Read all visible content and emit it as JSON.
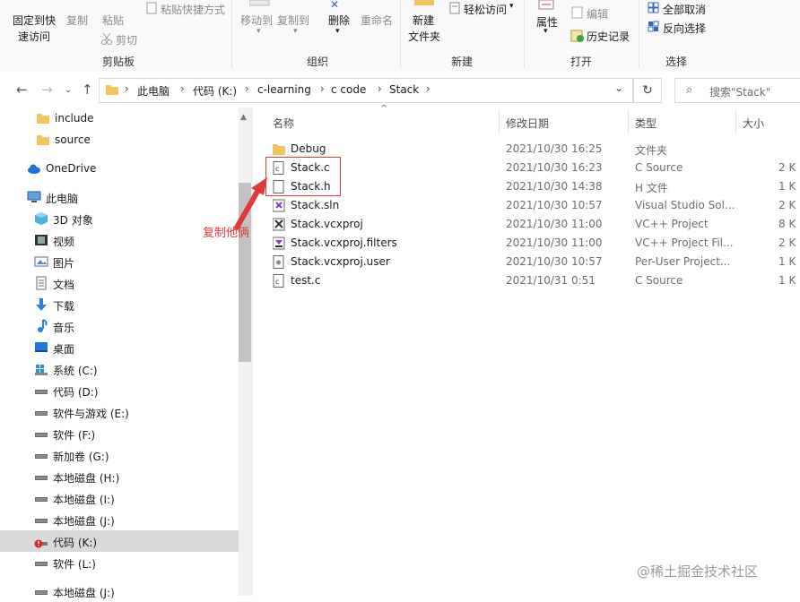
{
  "ribbon": {
    "pin_label_1": "固定到快",
    "pin_label_2": "速访问",
    "copy_label": "复制",
    "paste_label": "粘贴",
    "paste_shortcut_label": "粘贴快捷方式",
    "cut_label": "剪切",
    "move_to_label": "移动到",
    "copy_to_label": "复制到",
    "delete_label": "删除",
    "rename_label": "重命名",
    "new_folder_label_1": "新建",
    "new_folder_label_2": "文件夹",
    "easy_access_label": "轻松访问",
    "properties_label": "属性",
    "edit_label": "编辑",
    "history_label": "历史记录",
    "select_none_label": "全部取消",
    "invert_selection_label": "反向选择",
    "groups": {
      "clipboard": "剪贴板",
      "organize": "组织",
      "new": "新建",
      "open": "打开",
      "select": "选择"
    }
  },
  "address": {
    "crumbs": [
      "此电脑",
      "代码 (K:)",
      "c-learning",
      "c code",
      "Stack"
    ],
    "search_placeholder": "搜索\"Stack\""
  },
  "nav": {
    "items": [
      {
        "label": "include",
        "icon": "folder-icon"
      },
      {
        "label": "source",
        "icon": "folder-icon"
      },
      {
        "label": "OneDrive",
        "icon": "cloud-icon"
      },
      {
        "label": "此电脑",
        "icon": "computer-icon"
      },
      {
        "label": "3D 对象",
        "icon": "cube-icon"
      },
      {
        "label": "视频",
        "icon": "video-icon"
      },
      {
        "label": "图片",
        "icon": "picture-icon"
      },
      {
        "label": "文档",
        "icon": "document-icon"
      },
      {
        "label": "下载",
        "icon": "download-icon"
      },
      {
        "label": "音乐",
        "icon": "music-icon"
      },
      {
        "label": "桌面",
        "icon": "desktop-icon"
      },
      {
        "label": "系统 (C:)",
        "icon": "windows-drive-icon"
      },
      {
        "label": "代码 (D:)",
        "icon": "drive-icon"
      },
      {
        "label": "软件与游戏 (E:)",
        "icon": "drive-icon"
      },
      {
        "label": "软件 (F:)",
        "icon": "drive-icon"
      },
      {
        "label": "新加卷 (G:)",
        "icon": "drive-icon"
      },
      {
        "label": "本地磁盘 (H:)",
        "icon": "drive-icon"
      },
      {
        "label": "本地磁盘 (I:)",
        "icon": "drive-icon"
      },
      {
        "label": "本地磁盘 (J:)",
        "icon": "drive-icon"
      },
      {
        "label": "代码 (K:)",
        "icon": "drive-warning-icon"
      },
      {
        "label": "软件 (L:)",
        "icon": "drive-icon"
      },
      {
        "label": "本地磁盘 (J:)",
        "icon": "drive-icon"
      }
    ]
  },
  "columns": {
    "name": "名称",
    "date": "修改日期",
    "type": "类型",
    "size": "大小"
  },
  "files": [
    {
      "name": "Debug",
      "date": "2021/10/30 16:25",
      "type": "文件夹",
      "size": "",
      "icon": "folder-icon"
    },
    {
      "name": "Stack.c",
      "date": "2021/10/30 16:23",
      "type": "C Source",
      "size": "2 K",
      "icon": "c-file-icon"
    },
    {
      "name": "Stack.h",
      "date": "2021/10/30 14:38",
      "type": "H 文件",
      "size": "1 K",
      "icon": "h-file-icon"
    },
    {
      "name": "Stack.sln",
      "date": "2021/10/30 10:57",
      "type": "Visual Studio Sol...",
      "size": "2 K",
      "icon": "sln-file-icon"
    },
    {
      "name": "Stack.vcxproj",
      "date": "2021/10/30 11:00",
      "type": "VC++ Project",
      "size": "8 K",
      "icon": "vcxproj-file-icon"
    },
    {
      "name": "Stack.vcxproj.filters",
      "date": "2021/10/30 11:00",
      "type": "VC++ Project Fil...",
      "size": "2 K",
      "icon": "filters-file-icon"
    },
    {
      "name": "Stack.vcxproj.user",
      "date": "2021/10/30 10:57",
      "type": "Per-User Project...",
      "size": "1 K",
      "icon": "user-file-icon"
    },
    {
      "name": "test.c",
      "date": "2021/10/31 0:51",
      "type": "C Source",
      "size": "1 K",
      "icon": "c-file-icon"
    }
  ],
  "annotation": {
    "text": "复制他俩",
    "color": "#e03a3a"
  },
  "watermark": "@稀土掘金技术社区",
  "colors": {
    "selected_nav": "#d9d9d9",
    "folder": "#f2c55c",
    "annotation": "#e03a3a"
  }
}
